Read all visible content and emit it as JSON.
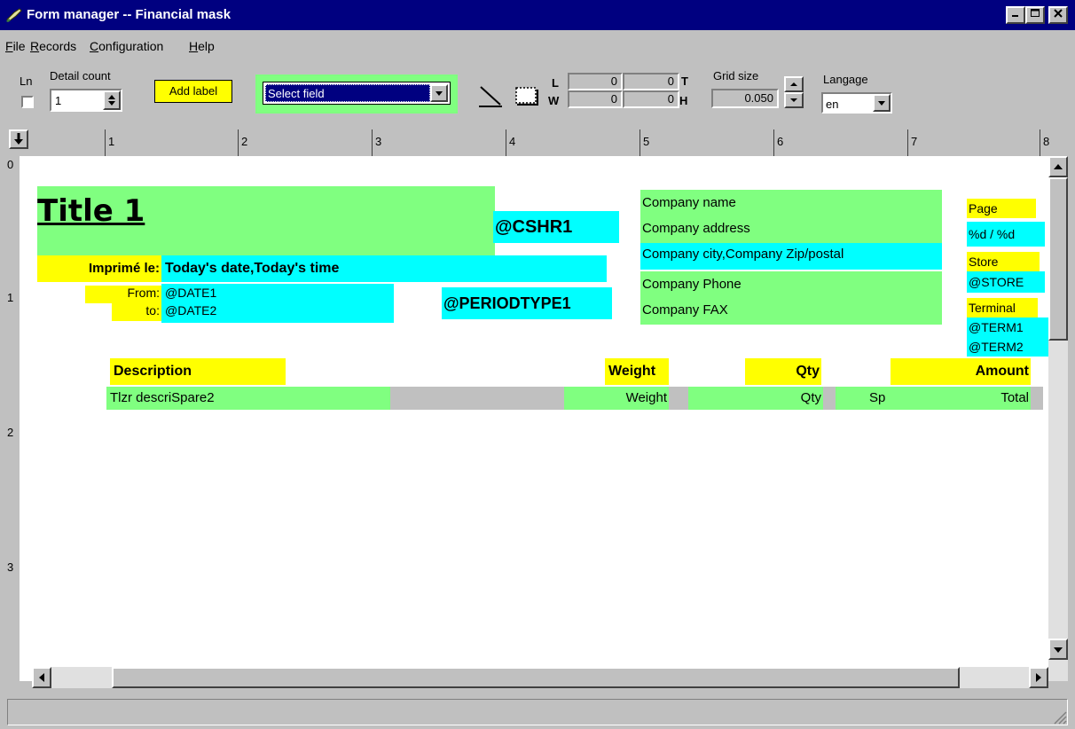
{
  "window": {
    "title": "Form manager -- Financial mask",
    "min": "_",
    "max": "□",
    "close": "✕"
  },
  "menu": [
    {
      "label": "File",
      "key": "F",
      "rest": "ile"
    },
    {
      "label": "Records",
      "key": "R",
      "rest": "ecords"
    },
    {
      "label": "Configuration",
      "key": "C",
      "rest": "onfiguration"
    },
    {
      "label": "Help",
      "key": "H",
      "rest": "elp"
    }
  ],
  "toolbar": {
    "ln_label": "Ln",
    "detail_count_label": "Detail count",
    "detail_count_value": "1",
    "add_label_button": "Add label",
    "select_field_value": "Select field",
    "l_label": "L",
    "w_label": "W",
    "t_label": "T",
    "h_label": "H",
    "l_value": "0",
    "t_value": "0",
    "w_value": "0",
    "h_value": "0",
    "grid_size_label": "Grid size",
    "grid_size_value": "0.050",
    "language_label": "Langage",
    "language_value": "en"
  },
  "ruler": {
    "h_marks": [
      "1",
      "2",
      "3",
      "4",
      "5",
      "6",
      "7",
      "8"
    ],
    "v_marks": [
      "0",
      "1",
      "2",
      "3"
    ]
  },
  "form": {
    "title": "Title 1",
    "cshr": "@CSHR1",
    "printed_label": "Imprimé le:",
    "printed_value": "Today's date,Today's time",
    "from_label": "From:",
    "from_value": "@DATE1",
    "to_label": "to:",
    "to_value": "@DATE2",
    "periodtype": "@PERIODTYPE1",
    "company_name": "Company name",
    "company_address": "Company address",
    "company_city": "Company city,Company Zip/postal",
    "company_phone": "Company Phone",
    "company_fax": "Company FAX",
    "page_label": "Page",
    "page_value": "%d / %d",
    "store_label": "Store",
    "store_value": "@STORE",
    "terminal_label": "Terminal",
    "term1": "@TERM1",
    "term2": "@TERM2",
    "col_description": "Description",
    "col_weight": "Weight",
    "col_qty": "Qty",
    "col_amount": "Amount",
    "row_description": "Tlzr descriSpare2",
    "row_weight": "Weight",
    "row_qty": "Qty",
    "row_sp": "Sp",
    "row_total": "Total"
  },
  "colors": {
    "titlebar": "#000080",
    "green": "#80ff80",
    "cyan": "#00ffff",
    "yellow": "#ffff00"
  }
}
